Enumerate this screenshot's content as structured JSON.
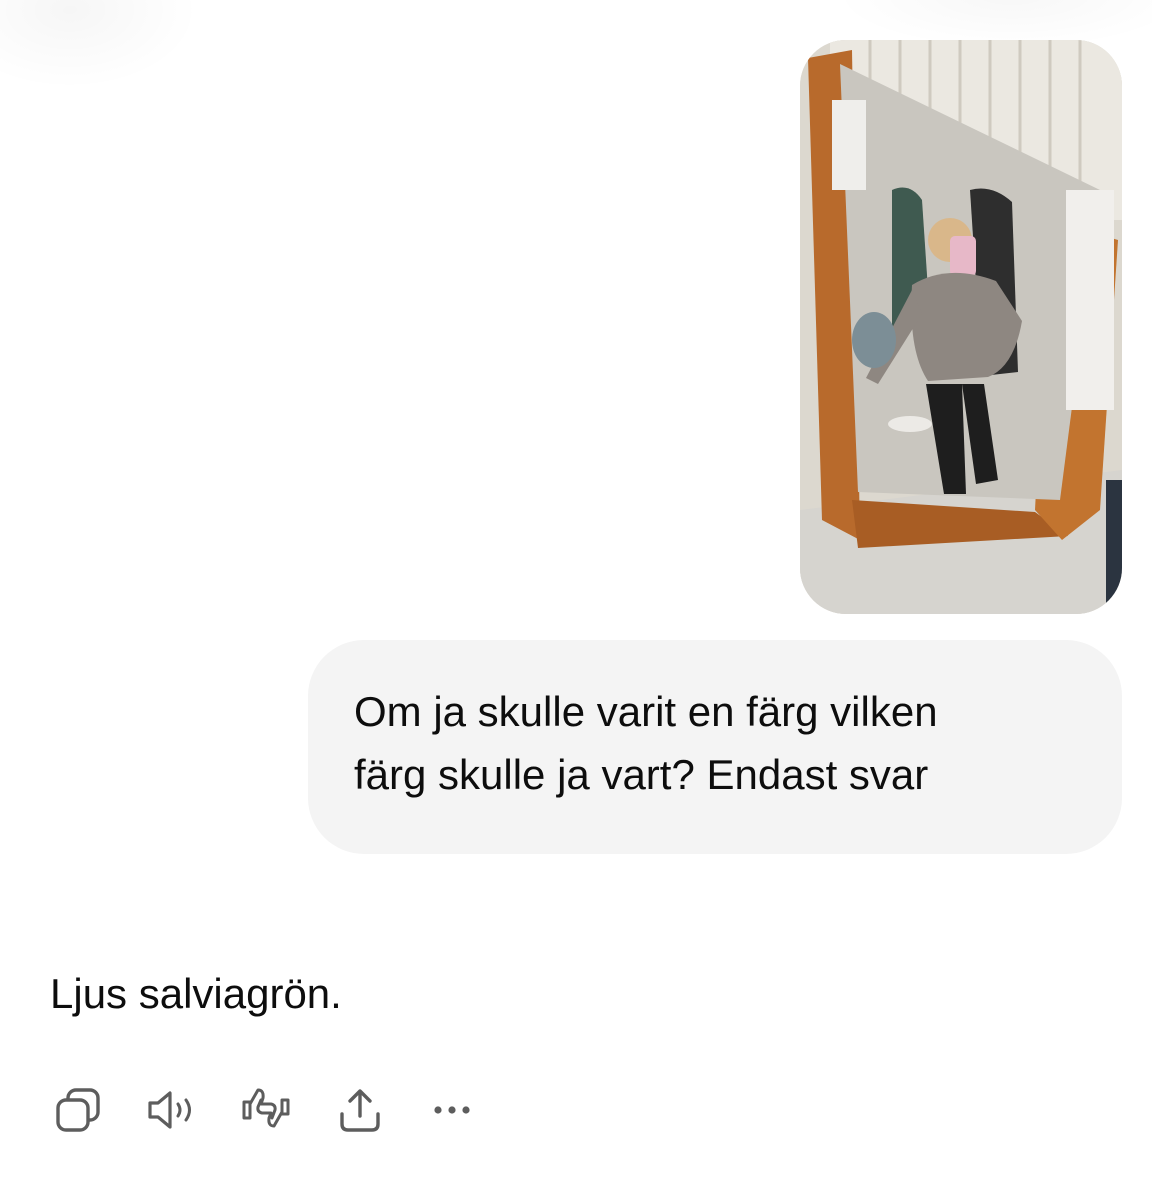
{
  "conversation": {
    "user_message": {
      "attachment": {
        "type": "image",
        "icon": "mirror-selfie-photo"
      },
      "text": "Om ja skulle varit en färg vilken\nfärg skulle ja vart? Endast svar"
    },
    "assistant_message": {
      "text": "Ljus salviagrön."
    },
    "actions": [
      {
        "name": "copy",
        "icon": "copy-icon"
      },
      {
        "name": "read-aloud",
        "icon": "speaker-icon"
      },
      {
        "name": "feedback",
        "icon": "thumbs-feedback-icon"
      },
      {
        "name": "share",
        "icon": "share-icon"
      },
      {
        "name": "more",
        "icon": "more-icon"
      }
    ]
  },
  "colors": {
    "background": "#ffffff",
    "bubble": "#f4f4f4",
    "text": "#0d0d0d",
    "icon": "#5d5d5d"
  }
}
